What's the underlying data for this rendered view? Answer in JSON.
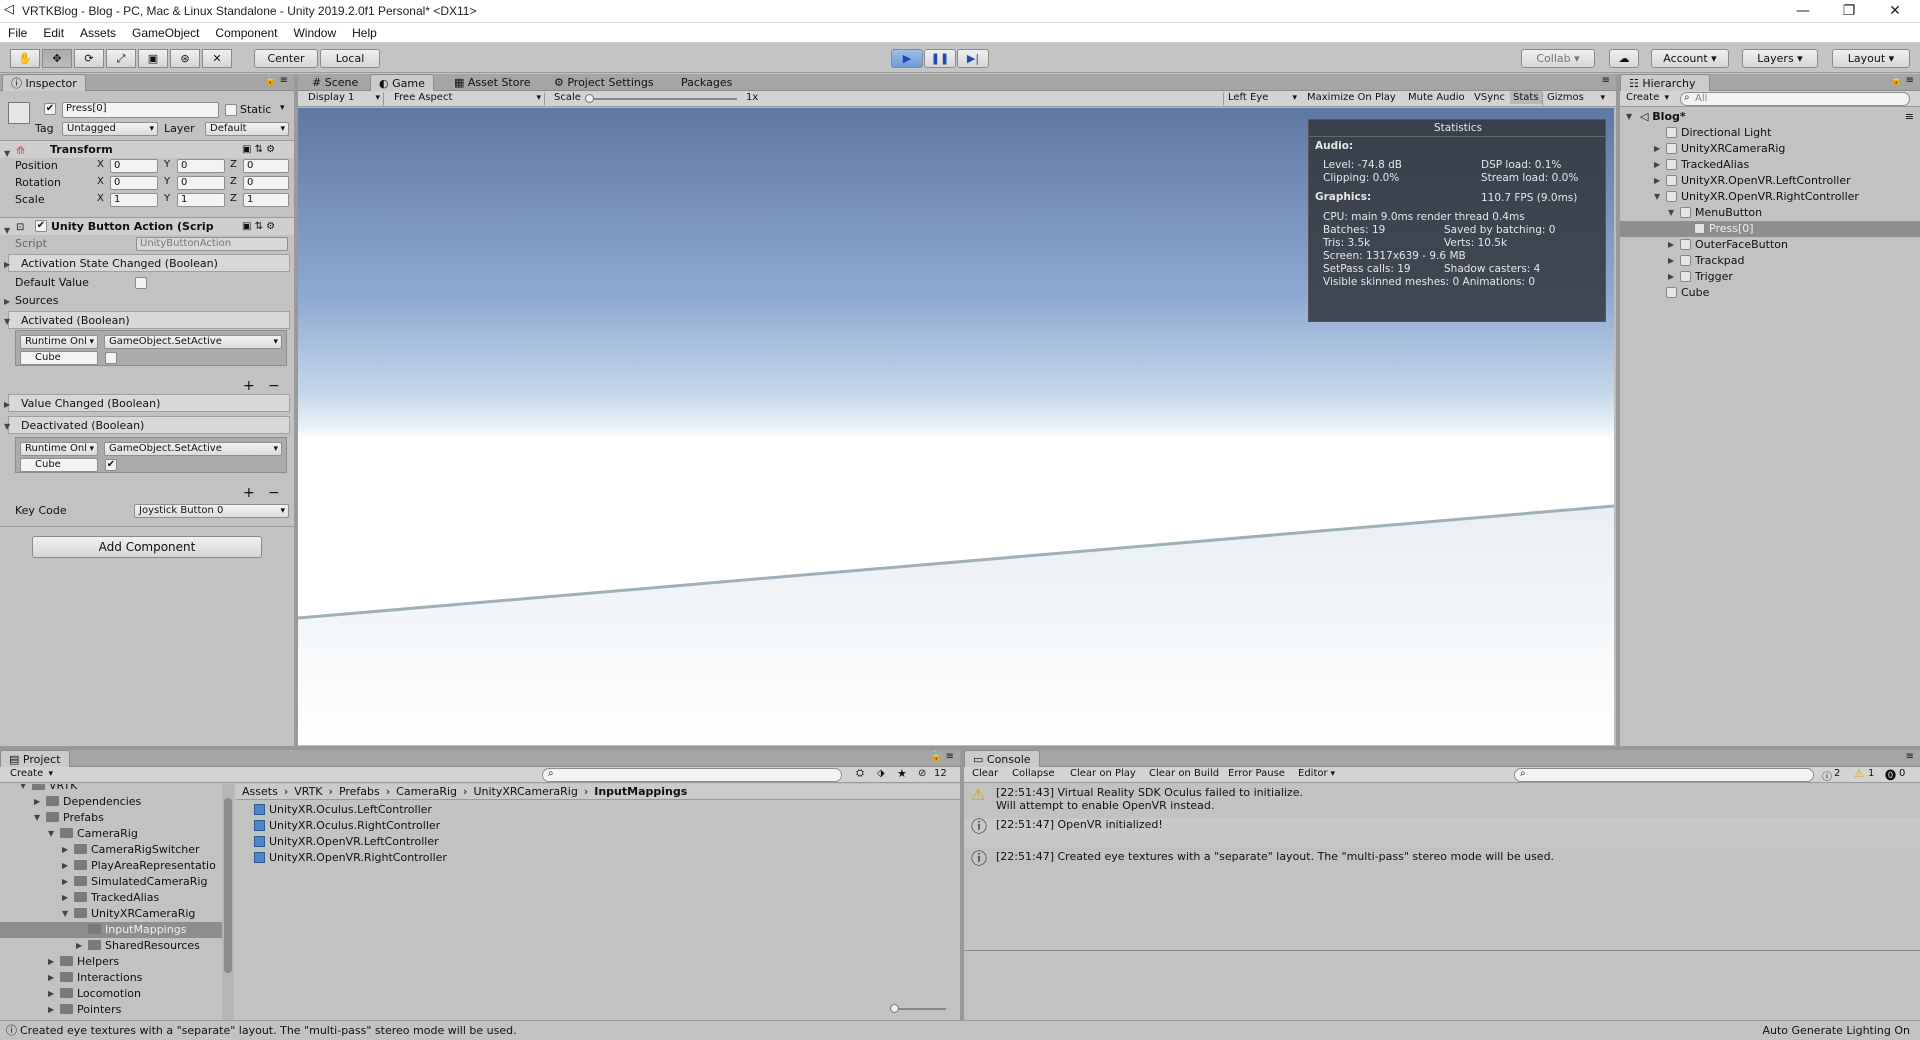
{
  "window": {
    "title": "VRTKBlog - Blog - PC, Mac & Linux Standalone - Unity 2019.2.0f1 Personal* <DX11>",
    "minimize": "—",
    "restore": "❐",
    "close": "✕"
  },
  "menu": [
    "File",
    "Edit",
    "Assets",
    "GameObject",
    "Component",
    "Window",
    "Help"
  ],
  "toolbar": {
    "center": "Center",
    "local": "Local",
    "collab": "Collab",
    "account": "Account",
    "layers": "Layers",
    "layout": "Layout"
  },
  "inspector": {
    "tab": "Inspector",
    "object_name": "Press[0]",
    "static_label": "Static",
    "tag_label": "Tag",
    "tag_value": "Untagged",
    "layer_label": "Layer",
    "layer_value": "Default",
    "transform": {
      "title": "Transform",
      "position": "Position",
      "rotation": "Rotation",
      "scale": "Scale",
      "pos": [
        "0",
        "0",
        "0"
      ],
      "rot": [
        "0",
        "0",
        "0"
      ],
      "scl": [
        "1",
        "1",
        "1"
      ]
    },
    "component": {
      "title": "Unity Button Action (Scrip",
      "script_label": "Script",
      "script_value": "UnityButtonAction",
      "activation_changed": "Activation State Changed (Boolean)",
      "default_value": "Default Value",
      "sources": "Sources",
      "activated": "Activated (Boolean)",
      "value_changed": "Value Changed (Boolean)",
      "deactivated": "Deactivated (Boolean)",
      "runtime": "Runtime Onl",
      "method": "GameObject.SetActive",
      "target": "Cube",
      "plus": "+",
      "minus": "−",
      "key_code_label": "Key Code",
      "key_code_value": "Joystick Button 0"
    },
    "add_component": "Add Component"
  },
  "center_tabs": [
    "Scene",
    "Game",
    "Asset Store",
    "Project Settings",
    "Packages"
  ],
  "game_bar": {
    "display": "Display 1",
    "aspect": "Free Aspect",
    "scale_label": "Scale",
    "scale_value": "1x",
    "eye": "Left Eye",
    "maximize": "Maximize On Play",
    "mute": "Mute Audio",
    "vsync": "VSync",
    "stats": "Stats",
    "gizmos": "Gizmos"
  },
  "stats": {
    "title": "Statistics",
    "audio": "Audio:",
    "level": "Level: -74.8 dB",
    "clipping": "Clipping: 0.0%",
    "dsp": "DSP load: 0.1%",
    "stream": "Stream load: 0.0%",
    "graphics": "Graphics:",
    "fps": "110.7 FPS (9.0ms)",
    "cpu": "CPU: main 9.0ms  render thread 0.4ms",
    "batches": "Batches: 19",
    "saved": "Saved by batching: 0",
    "tris": "Tris: 3.5k",
    "verts": "Verts: 10.5k",
    "screen": "Screen: 1317x639 - 9.6 MB",
    "setpass": "SetPass calls: 19",
    "shadow": "Shadow casters: 4",
    "skinned": "Visible skinned meshes: 0  Animations: 0"
  },
  "hierarchy": {
    "tab": "Hierarchy",
    "create": "Create",
    "search": "All",
    "scene": "Blog*",
    "items": [
      "Directional Light",
      "UnityXRCameraRig",
      "TrackedAlias",
      "UnityXR.OpenVR.LeftController",
      "UnityXR.OpenVR.RightController",
      "MenuButton",
      "Press[0]",
      "OuterFaceButton",
      "Trackpad",
      "Trigger",
      "Cube"
    ]
  },
  "project": {
    "tab": "Project",
    "create": "Create",
    "count": "12",
    "tree": [
      "VRTK",
      "Dependencies",
      "Prefabs",
      "CameraRig",
      "CameraRigSwitcher",
      "PlayAreaRepresentatio",
      "SimulatedCameraRig",
      "TrackedAlias",
      "UnityXRCameraRig",
      "InputMappings",
      "SharedResources",
      "Helpers",
      "Interactions",
      "Locomotion",
      "Pointers"
    ],
    "breadcrumb": [
      "Assets",
      "VRTK",
      "Prefabs",
      "CameraRig",
      "UnityXRCameraRig",
      "InputMappings"
    ],
    "assets": [
      "UnityXR.Oculus.LeftController",
      "UnityXR.Oculus.RightController",
      "UnityXR.OpenVR.LeftController",
      "UnityXR.OpenVR.RightController"
    ]
  },
  "console": {
    "tab": "Console",
    "clear": "Clear",
    "collapse": "Collapse",
    "clear_on_play": "Clear on Play",
    "clear_on_build": "Clear on Build",
    "error_pause": "Error Pause",
    "editor": "Editor",
    "count_log": "2",
    "count_warn": "1",
    "count_err": "0",
    "msg1a": "[22:51:43] Virtual Reality SDK Oculus failed to initialize.",
    "msg1b": "Will attempt to enable OpenVR instead.",
    "msg2": "[22:51:47] OpenVR initialized!",
    "msg3": "[22:51:47] Created eye textures with a \"separate\" layout.  The \"multi-pass\" stereo mode will be used."
  },
  "status": {
    "message": "Created eye textures with a \"separate\" layout.  The \"multi-pass\" stereo mode will be used.",
    "right": "Auto Generate Lighting On"
  }
}
